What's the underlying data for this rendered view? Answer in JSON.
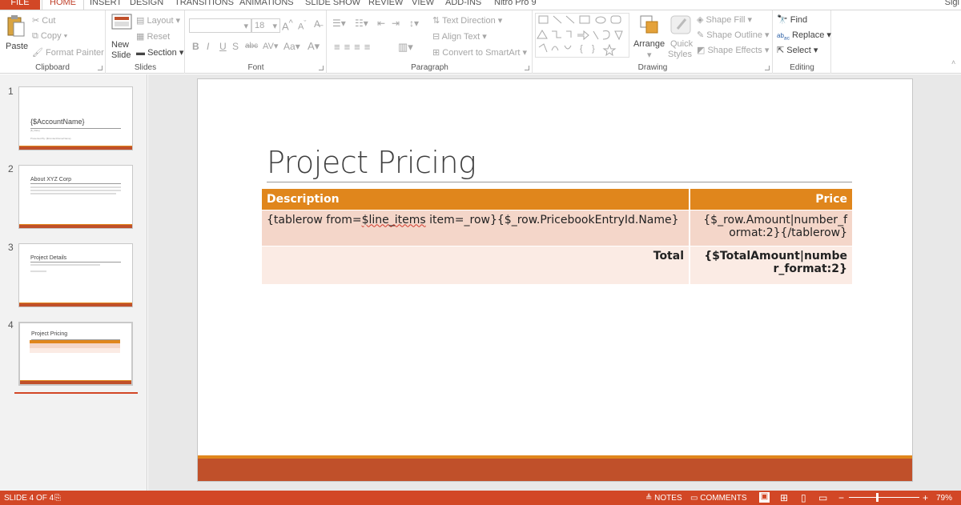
{
  "tabs": {
    "file": "FILE",
    "home": "HOME",
    "items": [
      "INSERT",
      "DESIGN",
      "TRANSITIONS",
      "ANIMATIONS",
      "SLIDE SHOW",
      "REVIEW",
      "VIEW",
      "ADD-INS",
      "Nitro Pro 9"
    ],
    "signin": "Sigi"
  },
  "clipboard": {
    "paste": "Paste",
    "cut": "Cut",
    "copy": "Copy",
    "format_painter": "Format Painter",
    "label": "Clipboard"
  },
  "slides": {
    "new_slide_1": "New",
    "new_slide_2": "Slide",
    "layout": "Layout",
    "reset": "Reset",
    "section": "Section",
    "label": "Slides"
  },
  "font": {
    "name": "",
    "size": "18",
    "label": "Font",
    "bold": "B",
    "italic": "I",
    "underline": "U",
    "shadow": "S",
    "strike": "abc",
    "spacing": "AV",
    "case": "Aa",
    "color": "A"
  },
  "paragraph": {
    "text_direction": "Text Direction",
    "align_text": "Align Text",
    "convert": "Convert to SmartArt",
    "label": "Paragraph"
  },
  "drawing": {
    "arrange": "Arrange",
    "quick_styles_1": "Quick",
    "quick_styles_2": "Styles",
    "shape_fill": "Shape Fill",
    "shape_outline": "Shape Outline",
    "shape_effects": "Shape Effects",
    "label": "Drawing"
  },
  "editing": {
    "find": "Find",
    "replace": "Replace",
    "select": "Select",
    "label": "Editing"
  },
  "thumbs": [
    {
      "num": "1",
      "title": "{$AccountName}",
      "sub1": "{$_Date}",
      "sub2": "Presented By: {$ContactOwnerName}"
    },
    {
      "num": "2",
      "title": "About XYZ Corp"
    },
    {
      "num": "3",
      "title": "Project Details"
    },
    {
      "num": "4",
      "title": "Project Pricing"
    }
  ],
  "slide": {
    "title": "Project Pricing",
    "table": {
      "headers": [
        "Description",
        "Price"
      ],
      "row1": {
        "pre": "{tablerow from=",
        "sq": "$line_items",
        "post": " item=_row}{$_row.PricebookEntryId.Name}",
        "price": "{$_row.Amount|number_format:2}{/tablerow}"
      },
      "row2": {
        "label": "Total",
        "price": "{$TotalAmount|number_format:2}"
      }
    }
  },
  "status": {
    "slide": "SLIDE 4 OF 4",
    "notes": "NOTES",
    "comments": "COMMENTS",
    "zoom": "79%"
  },
  "colors": {
    "accent": "#d24726",
    "table_header": "#e0861c",
    "footer": "#c0502a"
  }
}
